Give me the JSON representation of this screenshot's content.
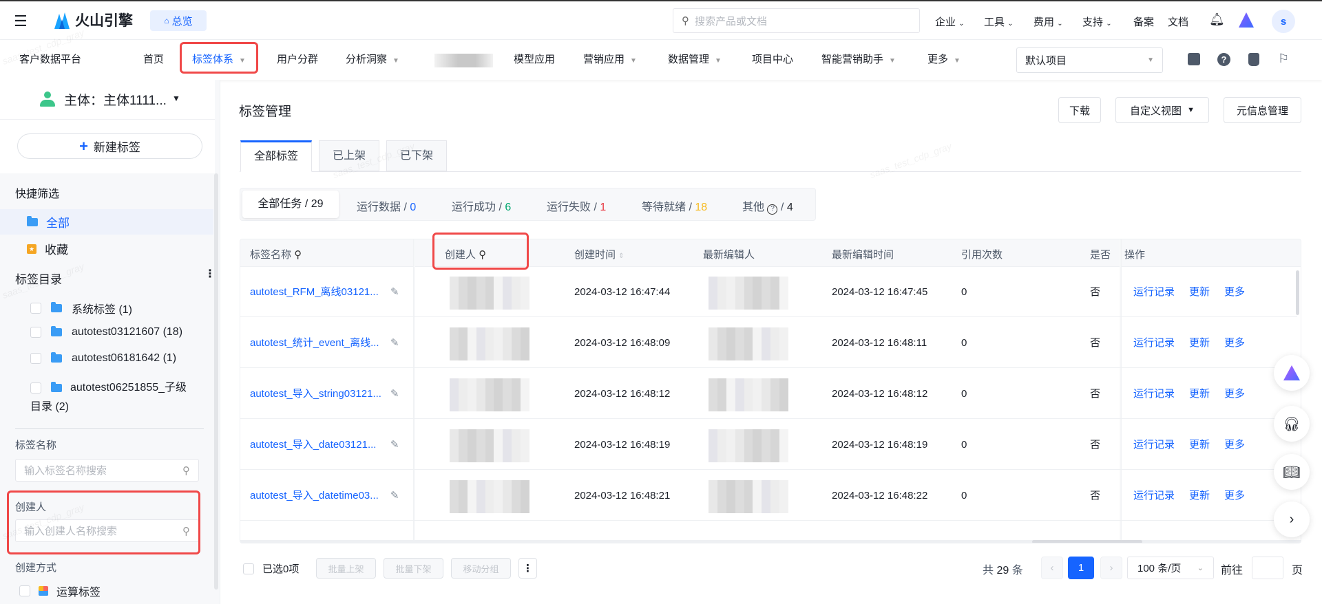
{
  "topbar": {
    "brand": "火山引擎",
    "overview": "总览",
    "search_placeholder": "搜索产品或文档",
    "menus": [
      "企业",
      "工具",
      "费用",
      "支持"
    ],
    "links": [
      "备案",
      "文档"
    ],
    "avatar": "s"
  },
  "navbar": {
    "platform": "客户数据平台",
    "items": [
      {
        "label": "首页",
        "dropdown": false
      },
      {
        "label": "标签体系",
        "dropdown": true,
        "active": true
      },
      {
        "label": "用户分群",
        "dropdown": false
      },
      {
        "label": "分析洞察",
        "dropdown": true
      },
      {
        "label": "模型应用",
        "dropdown": false
      },
      {
        "label": "营销应用",
        "dropdown": true
      },
      {
        "label": "数据管理",
        "dropdown": true
      },
      {
        "label": "项目中心",
        "dropdown": false
      },
      {
        "label": "智能营销助手",
        "dropdown": true
      },
      {
        "label": "更多",
        "dropdown": true
      }
    ],
    "project_select": "默认项目"
  },
  "sidebar": {
    "subject": "主体：主体1111...",
    "new_tag": "新建标签",
    "quick_filter_title": "快捷筛选",
    "quick_filters": [
      "全部",
      "收藏"
    ],
    "catalog_title": "标签目录",
    "catalog": [
      "系统标签 (1)",
      "autotest03121607 (18)",
      "autotest06181642 (1)",
      "autotest06251855_子级目录 (2)"
    ],
    "tag_name_label": "标签名称",
    "tag_name_placeholder": "输入标签名称搜索",
    "creator_label": "创建人",
    "creator_placeholder": "输入创建人名称搜索",
    "create_method_label": "创建方式",
    "create_methods": [
      "运算标签"
    ]
  },
  "main": {
    "title": "标签管理",
    "actions": {
      "download": "下载",
      "custom_view": "自定义视图",
      "meta": "元信息管理"
    },
    "tabs": [
      "全部标签",
      "已上架",
      "已下架"
    ],
    "status_filters": [
      {
        "label": "全部任务",
        "count": "29",
        "color": "#1d2129"
      },
      {
        "label": "运行数据",
        "count": "0",
        "color": "#1664ff"
      },
      {
        "label": "运行成功",
        "count": "6",
        "color": "#00a66e"
      },
      {
        "label": "运行失败",
        "count": "1",
        "color": "#e8323c"
      },
      {
        "label": "等待就绪",
        "count": "18",
        "color": "#f7ba1e"
      },
      {
        "label": "其他",
        "count": "4",
        "color": "#1d2129"
      }
    ],
    "columns": [
      "标签名称",
      "创建人",
      "创建时间",
      "最新编辑人",
      "最新编辑时间",
      "引用次数",
      "是否",
      "操作"
    ],
    "rows": [
      {
        "name": "autotest_RFM_离线03121...",
        "created": "2024-03-12 16:47:44",
        "edited": "2024-03-12 16:47:45",
        "refs": "0",
        "flag": "否"
      },
      {
        "name": "autotest_统计_event_离线...",
        "created": "2024-03-12 16:48:09",
        "edited": "2024-03-12 16:48:11",
        "refs": "0",
        "flag": "否"
      },
      {
        "name": "autotest_导入_string03121...",
        "created": "2024-03-12 16:48:12",
        "edited": "2024-03-12 16:48:12",
        "refs": "0",
        "flag": "否"
      },
      {
        "name": "autotest_导入_date03121...",
        "created": "2024-03-12 16:48:19",
        "edited": "2024-03-12 16:48:19",
        "refs": "0",
        "flag": "否"
      },
      {
        "name": "autotest_导入_datetime03...",
        "created": "2024-03-12 16:48:21",
        "edited": "2024-03-12 16:48:22",
        "refs": "0",
        "flag": "否"
      }
    ],
    "row_actions": [
      "运行记录",
      "更新",
      "更多"
    ],
    "footer": {
      "selected": "已选0项",
      "bulk": [
        "批量上架",
        "批量下架",
        "移动分组"
      ],
      "total_prefix": "共",
      "total": "29",
      "total_suffix": "条",
      "page": "1",
      "page_size": "100 条/页",
      "goto": "前往",
      "page_unit": "页"
    }
  },
  "watermark": "saas_test_cdp_gray",
  "colors": {
    "accent": "#1664ff",
    "highlight": "#f04848"
  }
}
